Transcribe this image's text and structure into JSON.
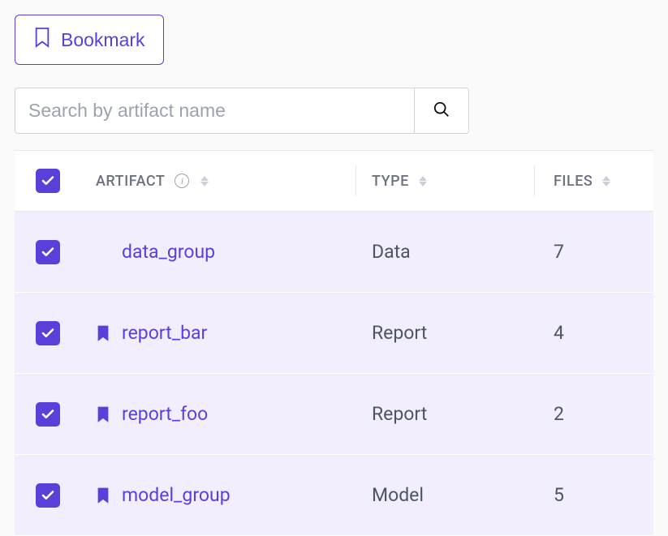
{
  "toolbar": {
    "bookmark_label": "Bookmark"
  },
  "search": {
    "placeholder": "Search by artifact name",
    "value": ""
  },
  "table": {
    "headers": {
      "artifact": "ARTIFACT",
      "type": "TYPE",
      "files": "FILES"
    },
    "select_all_checked": true,
    "rows": [
      {
        "checked": true,
        "bookmarked": false,
        "name": "data_group",
        "type": "Data",
        "files": "7"
      },
      {
        "checked": true,
        "bookmarked": true,
        "name": "report_bar",
        "type": "Report",
        "files": "4"
      },
      {
        "checked": true,
        "bookmarked": true,
        "name": "report_foo",
        "type": "Report",
        "files": "2"
      },
      {
        "checked": true,
        "bookmarked": true,
        "name": "model_group",
        "type": "Model",
        "files": "5"
      }
    ]
  }
}
